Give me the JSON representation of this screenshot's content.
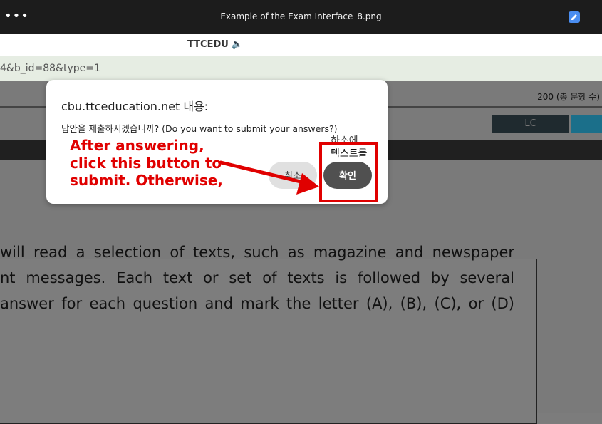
{
  "window": {
    "title": "Example of the Exam Interface_8.png",
    "menu_icon": "more-dots-icon",
    "edit_icon": "edit-pen-icon"
  },
  "tab": {
    "title": "TTCEDU",
    "icon": "speaker-icon",
    "icon_glyph": "🔈"
  },
  "url": {
    "text": "4&b_id=88&type=1"
  },
  "exam": {
    "question_count_text": "200 (총 문항 수)",
    "lc_label": "LC",
    "directions_lines": [
      "will read a selection of texts, such as magazine and newspaper",
      "nt messages. Each text or set of texts is followed by several",
      "answer for each question and mark the letter (A), (B), (C), or (D)"
    ]
  },
  "dialog": {
    "title": "cbu.ttceducation.net 내용:",
    "message": "답안을 제출하시겠습니까? (Do you want to submit your answers?)",
    "cancel_label": "취소",
    "ok_label": "확인"
  },
  "overlay_text": {
    "line1": "하소에",
    "line2": "텍스트를"
  },
  "annotation": {
    "line1": "After answering,",
    "line2": "click this button to",
    "line3": "submit. Otherwise,",
    "color": "#e00000"
  },
  "colors": {
    "titlebar": "#1c1c1c",
    "urlbar": "#e6ede3",
    "dim_background": "#7a7a7a",
    "ok_button": "#505050",
    "cancel_button": "#e0e0e0",
    "lc_button": "#1f2a2f",
    "rc_button": "#1b6f8a"
  }
}
